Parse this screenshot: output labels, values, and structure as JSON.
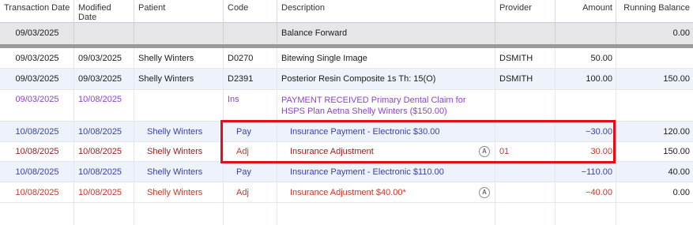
{
  "columns": {
    "transaction_date": "Transaction Date",
    "modified_date": "Modified Date",
    "patient": "Patient",
    "code": "Code",
    "description": "Description",
    "provider": "Provider",
    "amount": "Amount",
    "running_balance": "Running Balance"
  },
  "balance_forward": {
    "date": "09/03/2025",
    "description": "Balance Forward",
    "running_balance": "0.00"
  },
  "rows": [
    {
      "transaction_date": "09/03/2025",
      "modified_date": "09/03/2025",
      "patient": "Shelly Winters",
      "code": "D0270",
      "description": "Bitewing Single Image",
      "provider": "DSMITH",
      "amount": "50.00",
      "running_balance": ""
    },
    {
      "transaction_date": "09/03/2025",
      "modified_date": "09/03/2025",
      "patient": "Shelly Winters",
      "code": "D2391",
      "description": "Posterior Resin Composite 1s Th: 15(O)",
      "provider": "DSMITH",
      "amount": "100.00",
      "running_balance": "150.00"
    },
    {
      "transaction_date": "09/03/2025",
      "modified_date": "10/08/2025",
      "patient": "",
      "code": "Ins",
      "description": "PAYMENT RECEIVED Primary Dental Claim for HSPS Plan Aetna Shelly Winters ($150.00)",
      "provider": "",
      "amount": "",
      "running_balance": ""
    },
    {
      "transaction_date": "10/08/2025",
      "modified_date": "10/08/2025",
      "patient": "Shelly Winters",
      "code": "Pay",
      "description": "Insurance Payment - Electronic $30.00",
      "provider": "",
      "amount": "−30.00",
      "running_balance": "120.00"
    },
    {
      "transaction_date": "10/08/2025",
      "modified_date": "10/08/2025",
      "patient": "Shelly Winters",
      "code": "Adj",
      "description": "Insurance Adjustment",
      "badge": "A",
      "provider": "01",
      "amount": "30.00",
      "running_balance": "150.00"
    },
    {
      "transaction_date": "10/08/2025",
      "modified_date": "10/08/2025",
      "patient": "Shelly Winters",
      "code": "Pay",
      "description": "Insurance Payment - Electronic $110.00",
      "provider": "",
      "amount": "−110.00",
      "running_balance": "40.00"
    },
    {
      "transaction_date": "10/08/2025",
      "modified_date": "10/08/2025",
      "patient": "Shelly Winters",
      "code": "Adj",
      "description": "Insurance Adjustment $40.00*",
      "badge": "A",
      "provider": "",
      "amount": "−40.00",
      "running_balance": "0.00"
    }
  ],
  "colors": {
    "payment_text": "#3a3f9c",
    "adjustment_text": "#c0392b",
    "insurance_text": "#8a45c9",
    "highlight_border": "#e0101a"
  }
}
